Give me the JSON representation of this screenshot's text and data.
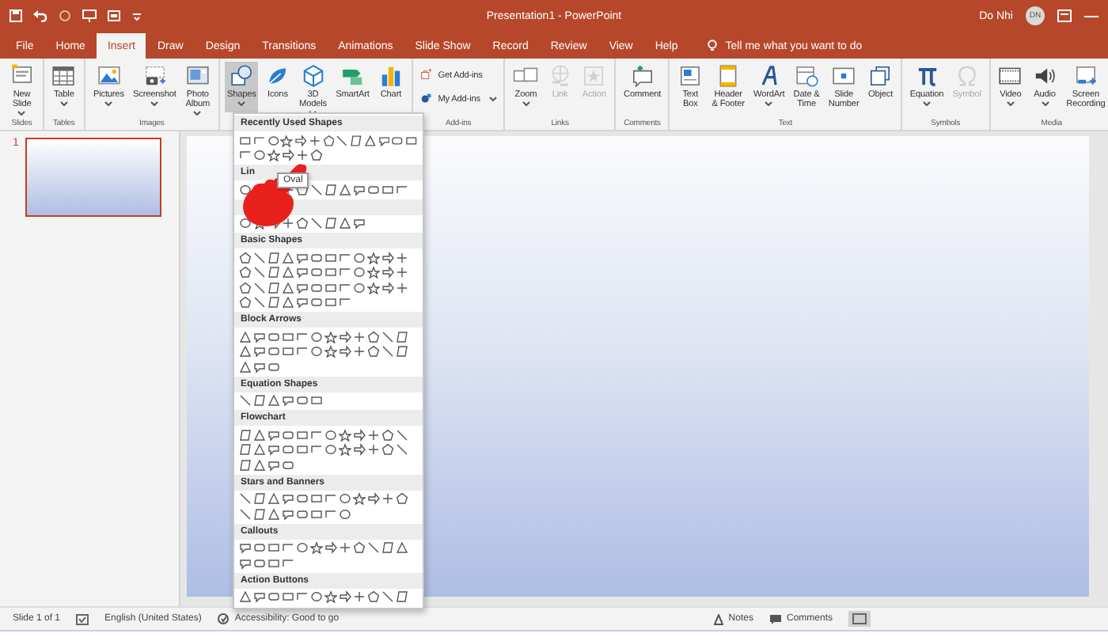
{
  "window": {
    "title": "Presentation1  -  PowerPoint",
    "user": "Do Nhi",
    "avatar": "DN"
  },
  "tabs": [
    {
      "label": "File",
      "selected": false
    },
    {
      "label": "Home",
      "selected": false
    },
    {
      "label": "Insert",
      "selected": true
    },
    {
      "label": "Draw",
      "selected": false
    },
    {
      "label": "Design",
      "selected": false
    },
    {
      "label": "Transitions",
      "selected": false
    },
    {
      "label": "Animations",
      "selected": false
    },
    {
      "label": "Slide Show",
      "selected": false
    },
    {
      "label": "Record",
      "selected": false
    },
    {
      "label": "Review",
      "selected": false
    },
    {
      "label": "View",
      "selected": false
    },
    {
      "label": "Help",
      "selected": false
    }
  ],
  "tell_me": "Tell me what you want to do",
  "ribbon_groups": [
    {
      "label": "Slides",
      "buttons": [
        {
          "kind": "large",
          "label": "New\nSlide",
          "dropdown": true,
          "disabled": false,
          "selected": false
        }
      ]
    },
    {
      "label": "Tables",
      "buttons": [
        {
          "kind": "large",
          "label": "Table",
          "dropdown": true,
          "disabled": false,
          "selected": false
        }
      ]
    },
    {
      "label": "Images",
      "buttons": [
        {
          "kind": "large",
          "label": "Pictures",
          "dropdown": true,
          "disabled": false,
          "selected": false
        },
        {
          "kind": "large",
          "label": "Screenshot",
          "dropdown": true,
          "disabled": false,
          "selected": false
        },
        {
          "kind": "large",
          "label": "Photo\nAlbum",
          "dropdown": true,
          "disabled": false,
          "selected": false
        }
      ]
    },
    {
      "buttons": [
        {
          "kind": "large",
          "label": "Shapes",
          "dropdown": true,
          "disabled": false,
          "selected": true
        },
        {
          "kind": "large",
          "label": "Icons",
          "dropdown": false,
          "disabled": false,
          "selected": false
        },
        {
          "kind": "large",
          "label": "3D\nModels",
          "dropdown": true,
          "disabled": false,
          "selected": false
        },
        {
          "kind": "large",
          "label": "SmartArt",
          "dropdown": false,
          "disabled": false,
          "selected": false
        },
        {
          "kind": "large",
          "label": "Chart",
          "dropdown": false,
          "disabled": false,
          "selected": false
        }
      ]
    },
    {
      "label": "Add-ins",
      "buttons": [
        {
          "kind": "small",
          "label": "Get Add-ins",
          "dropdown": false,
          "disabled": false,
          "selected": false
        },
        {
          "kind": "small",
          "label": "My Add-ins",
          "dropdown": true,
          "disabled": false,
          "selected": false
        }
      ]
    },
    {
      "label": "Links",
      "buttons": [
        {
          "kind": "large",
          "label": "Zoom",
          "dropdown": true,
          "disabled": false,
          "selected": false
        },
        {
          "kind": "large",
          "label": "Link",
          "dropdown": false,
          "disabled": true,
          "selected": false
        },
        {
          "kind": "large",
          "label": "Action",
          "dropdown": false,
          "disabled": true,
          "selected": false
        }
      ]
    },
    {
      "label": "Comments",
      "buttons": [
        {
          "kind": "large",
          "label": "Comment",
          "dropdown": false,
          "disabled": false,
          "selected": false
        }
      ]
    },
    {
      "label": "Text",
      "buttons": [
        {
          "kind": "large",
          "label": "Text\nBox",
          "dropdown": false,
          "disabled": false,
          "selected": false
        },
        {
          "kind": "large",
          "label": "Header\n& Footer",
          "dropdown": false,
          "disabled": false,
          "selected": false
        },
        {
          "kind": "large",
          "label": "WordArt",
          "dropdown": true,
          "disabled": false,
          "selected": false
        },
        {
          "kind": "large",
          "label": "Date &\nTime",
          "dropdown": false,
          "disabled": false,
          "selected": false
        },
        {
          "kind": "large",
          "label": "Slide\nNumber",
          "dropdown": false,
          "disabled": false,
          "selected": false
        },
        {
          "kind": "large",
          "label": "Object",
          "dropdown": false,
          "disabled": false,
          "selected": false
        }
      ]
    },
    {
      "label": "Symbols",
      "buttons": [
        {
          "kind": "large",
          "label": "Equation",
          "dropdown": true,
          "disabled": false,
          "selected": false
        },
        {
          "kind": "large",
          "label": "Symbol",
          "dropdown": false,
          "disabled": true,
          "selected": false
        }
      ]
    },
    {
      "label": "Media",
      "buttons": [
        {
          "kind": "large",
          "label": "Video",
          "dropdown": true,
          "disabled": false,
          "selected": false
        },
        {
          "kind": "large",
          "label": "Audio",
          "dropdown": true,
          "disabled": false,
          "selected": false
        },
        {
          "kind": "large",
          "label": "Screen\nRecording",
          "dropdown": false,
          "disabled": false,
          "selected": false
        }
      ]
    }
  ],
  "thumbnails": [
    {
      "number": "1",
      "selected": true
    }
  ],
  "shapes_menu": {
    "tooltip": "Oval",
    "sections": [
      {
        "title": "Recently Used Shapes"
      },
      {
        "title": "Lin"
      },
      {
        "title": "Basic Shapes"
      },
      {
        "title": "Block Arrows"
      },
      {
        "title": "Equation Shapes"
      },
      {
        "title": "Flowchart"
      },
      {
        "title": "Stars and Banners"
      },
      {
        "title": "Callouts"
      },
      {
        "title": "Action Buttons"
      }
    ]
  },
  "status_bar": {
    "slide": "Slide 1 of 1",
    "language": "English (United States)",
    "accessibility": "Accessibility: Good to go",
    "notes": "Notes",
    "comments": "Comments"
  }
}
